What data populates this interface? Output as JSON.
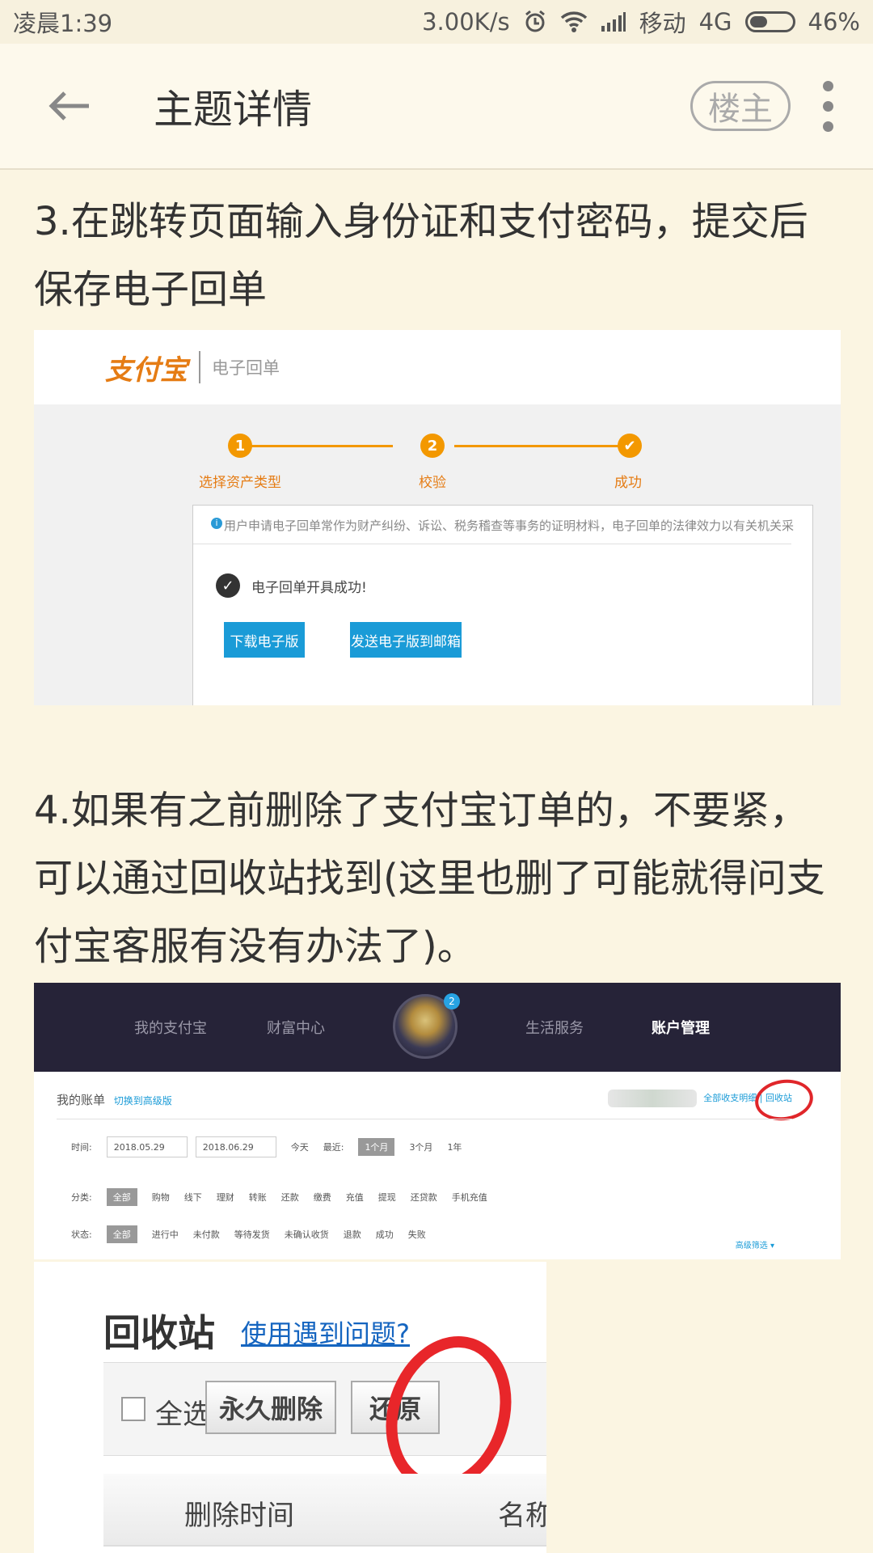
{
  "status_bar": {
    "time": "凌晨1:39",
    "speed": "3.00K/s",
    "carrier": "移动",
    "network": "4G",
    "battery": "46%",
    "battery_level": 0.46
  },
  "header": {
    "title": "主题详情",
    "louzhu_label": "楼主"
  },
  "content": {
    "para1": "3.在跳转页面输入身份证和支付密码，提交后保存电子回单",
    "para2": "4.如果有之前删除了支付宝订单的，不要紧，可以通过回收站找到(这里也删了可能就得问支付宝客服有没有办法了)。"
  },
  "image1": {
    "logo": "支付宝",
    "logo_sub": "电子回单",
    "steps": [
      {
        "num": "1",
        "label": "选择资产类型"
      },
      {
        "num": "2",
        "label": "校验"
      },
      {
        "num": "✔",
        "label": "成功"
      }
    ],
    "notice": "用户申请电子回单常作为财产纠纷、诉讼、税务稽查等事务的证明材料，电子回单的法律效力以有关机关采",
    "success_text": "电子回单开具成功!",
    "download_btn": "下载电子版",
    "email_btn": "发送电子版到邮箱"
  },
  "image2": {
    "nav": [
      "我的支付宝",
      "财富中心",
      "生活服务",
      "账户管理"
    ],
    "badge": "2",
    "my_bill": "我的账单",
    "switch_link": "切换到高级版",
    "right_links": "全部收支明细 | 回收站",
    "time_label": "时间:",
    "date_from": "2018.05.29",
    "date_to": "2018.06.29",
    "today": "今天",
    "recent_label": "最近:",
    "recent_options": [
      "1个月",
      "3个月",
      "1年"
    ],
    "category_label": "分类:",
    "categories": [
      "全部",
      "购物",
      "线下",
      "理财",
      "转账",
      "还款",
      "缴费",
      "充值",
      "提现",
      "还贷款",
      "手机充值"
    ],
    "status_label": "状态:",
    "statuses": [
      "全部",
      "进行中",
      "未付款",
      "等待发货",
      "未确认收货",
      "退款",
      "成功",
      "失败"
    ],
    "advanced": "高级筛选 ▾"
  },
  "image3": {
    "title": "回收站",
    "help_link": "使用遇到问题?",
    "select_all": "全选",
    "delete_btn": "永久删除",
    "restore_btn": "还原",
    "col_time": "删除时间",
    "col_name": "名称"
  }
}
